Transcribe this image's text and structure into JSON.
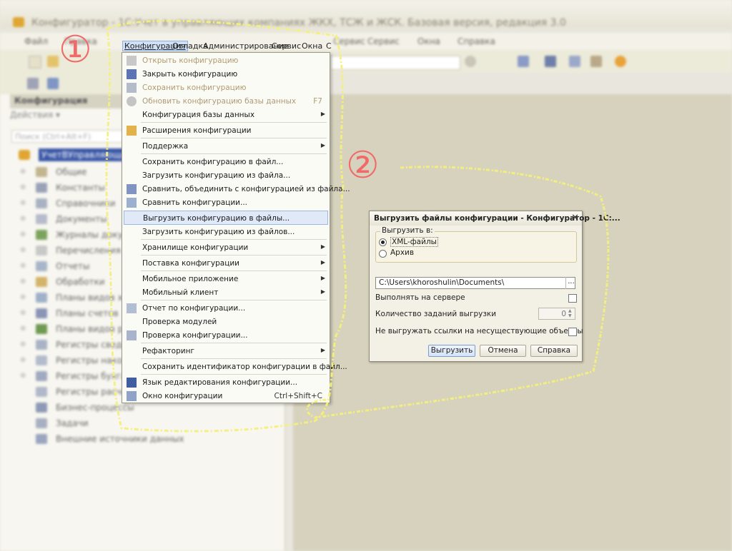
{
  "window": {
    "title": "Конфигуратор - 1С:Учет в управляющих компаниях ЖКХ, ТСЖ и ЖСК. Базовая версия, редакция 3.0"
  },
  "menubar": {
    "items": [
      "Файл",
      "Правка",
      "Конфигурация",
      "Отладка",
      "Администрирование",
      "Сервис",
      "Окна",
      "Справка"
    ]
  },
  "left_panel": {
    "header": "Конфигурация",
    "actions_label": "Действия ▾",
    "search_placeholder": "Поиск (Ctrl+Alt+F)",
    "root": "УчетВУправляющих",
    "items": [
      "Общие",
      "Константы",
      "Справочники",
      "Документы",
      "Журналы документов",
      "Перечисления",
      "Отчеты",
      "Обработки",
      "Планы видов характеристик",
      "Планы счетов",
      "Планы видов расчета",
      "Регистры сведений",
      "Регистры накопления",
      "Регистры бухгалтерии",
      "Регистры расчета",
      "Бизнес-процессы",
      "Задачи",
      "Внешние источники данных"
    ]
  },
  "menu_head": {
    "active": "Конфигурация",
    "others": [
      "Отладка",
      "Администрирование",
      "Сервис",
      "Окна",
      "С"
    ]
  },
  "dropdown": {
    "items": [
      {
        "label": "Открыть конфигурацию",
        "disabled": true
      },
      {
        "label": "Закрыть конфигурацию"
      },
      {
        "label": "Сохранить конфигурацию",
        "disabled": true
      },
      {
        "label": "Обновить конфигурацию базы данных",
        "shortcut": "F7",
        "disabled": true
      },
      {
        "label": "Конфигурация базы данных"
      },
      {
        "label": "Расширения конфигурации"
      },
      {
        "label": "Поддержка"
      },
      {
        "label": "Сохранить конфигурацию в файл..."
      },
      {
        "label": "Загрузить конфигурацию из файла..."
      },
      {
        "label": "Сравнить, объединить с конфигурацией из файла..."
      },
      {
        "label": "Сравнить конфигурации..."
      },
      {
        "label": "Выгрузить конфигурацию в файлы..."
      },
      {
        "label": "Загрузить конфигурацию из файлов..."
      },
      {
        "label": "Хранилище конфигурации"
      },
      {
        "label": "Поставка конфигурации"
      },
      {
        "label": "Мобильное приложение"
      },
      {
        "label": "Мобильный клиент"
      },
      {
        "label": "Отчет по конфигурации..."
      },
      {
        "label": "Проверка модулей"
      },
      {
        "label": "Проверка конфигурации..."
      },
      {
        "label": "Рефакторинг"
      },
      {
        "label": "Сохранить идентификатор конфигурации в файл..."
      },
      {
        "label": "Язык редактирования конфигурации..."
      },
      {
        "label": "Окно конфигурации",
        "shortcut": "Ctrl+Shift+C"
      }
    ]
  },
  "dialog": {
    "title": "Выгрузить файлы конфигурации - Конфигуратор - 1С:...",
    "group_label": "Выгрузить в:",
    "radio_xml": "XML-файлы",
    "radio_archive": "Архив",
    "path": "C:\\Users\\khoroshulin\\Documents\\",
    "browse": "...",
    "opt_server": "Выполнять на сервере",
    "opt_jobs": "Количество заданий выгрузки",
    "jobs_value": "0",
    "opt_no_refs": "Не выгружать ссылки на несуществующие объекты",
    "btn_export": "Выгрузить",
    "btn_cancel": "Отмена",
    "btn_help": "Справка"
  },
  "annotations": {
    "step1": "①",
    "step2": "②"
  },
  "colors": {
    "accent": "#3a57a6",
    "highlight_line": "#f4f07a",
    "badge": "#f06a6a"
  }
}
